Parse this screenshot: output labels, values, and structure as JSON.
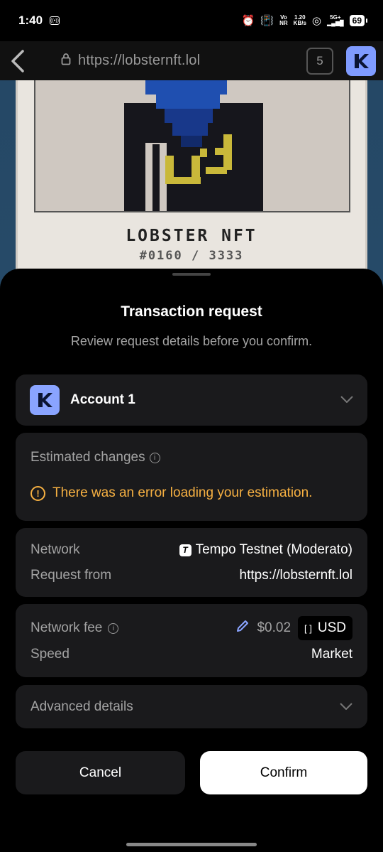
{
  "status_bar": {
    "time": "1:40",
    "network_label_top": "Vo",
    "network_label_bottom": "NR",
    "speed_top": "1.20",
    "speed_bottom": "KB/s",
    "signal_label": "5G+",
    "battery": "69"
  },
  "browser": {
    "url": "https://lobsternft.lol",
    "tab_count": "5"
  },
  "nft": {
    "title": "LOBSTER NFT",
    "number": "#0160 / 3333"
  },
  "sheet": {
    "title": "Transaction request",
    "subtitle": "Review request details before you confirm."
  },
  "account": {
    "name": "Account 1"
  },
  "estimated": {
    "label": "Estimated changes",
    "error": "There was an error loading your estimation."
  },
  "network": {
    "network_label": "Network",
    "network_value": "Tempo Testnet (Moderato)",
    "request_label": "Request from",
    "request_value": "https://lobsternft.lol"
  },
  "fee": {
    "label": "Network fee",
    "amount": "$0.02",
    "currency": "USD",
    "speed_label": "Speed",
    "speed_value": "Market"
  },
  "advanced": {
    "label": "Advanced details"
  },
  "buttons": {
    "cancel": "Cancel",
    "confirm": "Confirm"
  },
  "colors": {
    "accent": "#8aa4ff",
    "warning": "#f6b042",
    "card_bg": "#1a1a1c"
  }
}
